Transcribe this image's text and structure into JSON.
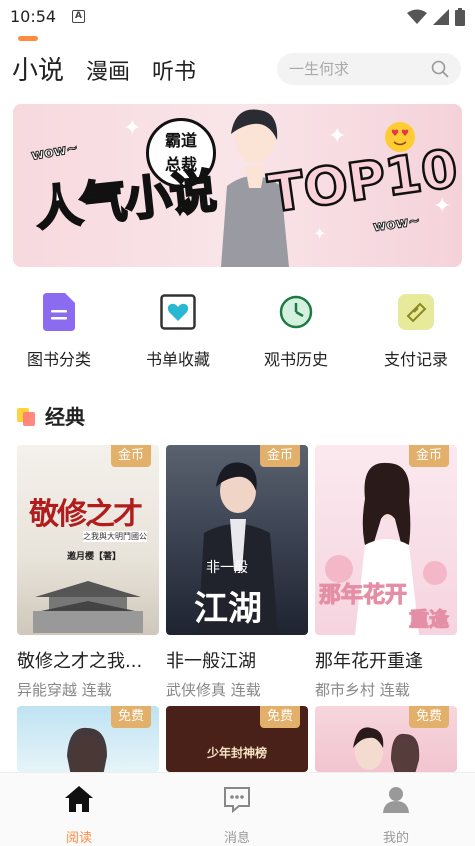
{
  "status_bar": {
    "time": "10:54",
    "a_icon": "A"
  },
  "tabs": [
    {
      "label": "小说",
      "active": true
    },
    {
      "label": "漫画",
      "active": false
    },
    {
      "label": "听书",
      "active": false
    }
  ],
  "search": {
    "placeholder": "一生何求",
    "icon": "search-icon"
  },
  "banner": {
    "badge_line1": "霸道",
    "badge_line2": "总裁",
    "wow_left": "wow~",
    "title": "人气小说",
    "top": "TOP10",
    "wow_right": "wow~"
  },
  "quick_entries": [
    {
      "label": "图书分类",
      "icon": "book-category-icon",
      "color": "#8b6cf0"
    },
    {
      "label": "书单收藏",
      "icon": "favorite-heart-icon",
      "color": "#28b8d4"
    },
    {
      "label": "观书历史",
      "icon": "clock-history-icon",
      "color": "#2a9d5c"
    },
    {
      "label": "支付记录",
      "icon": "ticket-icon",
      "color": "#c5c93a"
    }
  ],
  "section": {
    "title": "经典"
  },
  "books": [
    {
      "title": "敬修之才之我...",
      "sub": "异能穿越 连载",
      "tag": "金币",
      "cover_text": "敬修之才",
      "cover_sub": "之我與大明鬥國公",
      "cover_author": "邀月樱【著】"
    },
    {
      "title": "非一般江湖",
      "sub": "武侠修真 连载",
      "tag": "金币",
      "cover_text": "江湖",
      "cover_sub": "非一般"
    },
    {
      "title": "那年花开重逢",
      "sub": "都市乡村 连载",
      "tag": "金币",
      "cover_text": "那年花开",
      "cover_sub": "重逢"
    },
    {
      "tag": "免费"
    },
    {
      "tag": "免费",
      "cover_text": "少年封神榜"
    },
    {
      "tag": "免费"
    }
  ],
  "bottom_nav": [
    {
      "label": "阅读",
      "icon": "home-icon",
      "active": true
    },
    {
      "label": "消息",
      "icon": "message-icon",
      "active": false
    },
    {
      "label": "我的",
      "icon": "user-icon",
      "active": false
    }
  ],
  "colors": {
    "accent": "#ff8c42",
    "tag": "#e2b06a"
  }
}
